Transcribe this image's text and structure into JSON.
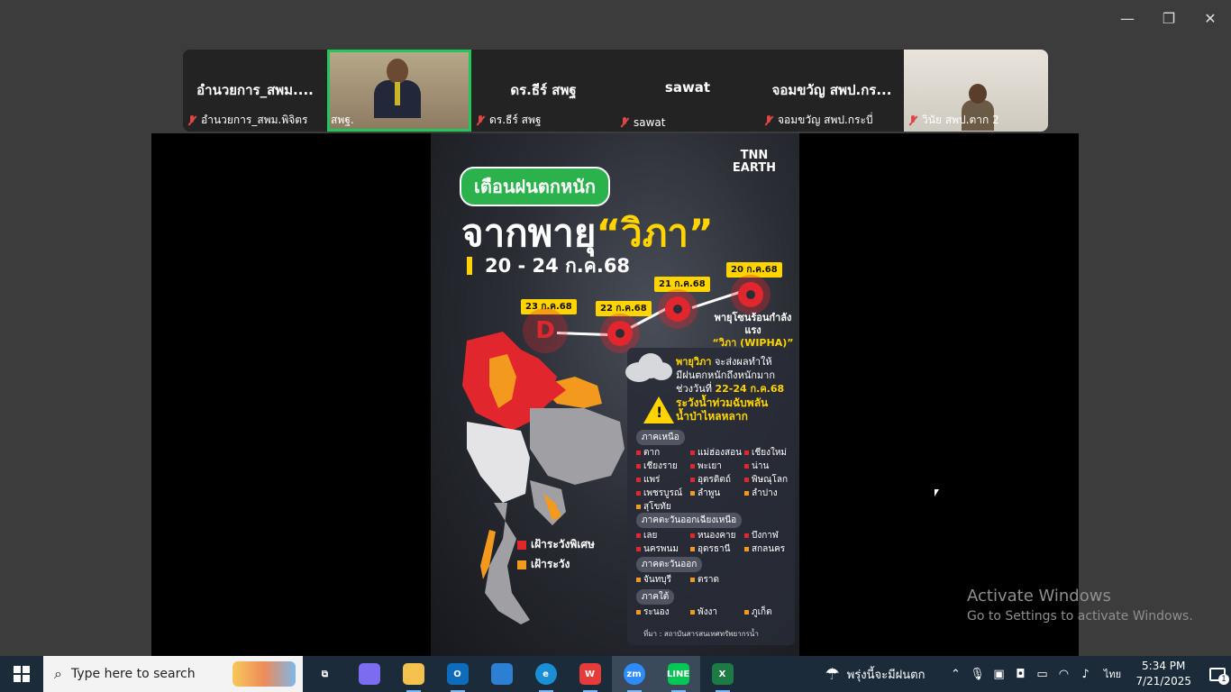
{
  "window": {
    "minimize": "—",
    "restore": "❐",
    "close": "✕"
  },
  "participants": [
    {
      "big_name": "อำนวยการ_สพม....",
      "label": "อำนวยการ_สพม.พิจิตร",
      "video": false,
      "muted": true
    },
    {
      "big_name": "",
      "label": "สพฐ.",
      "video": true,
      "muted": false,
      "active": true
    },
    {
      "big_name": "ดร.ธีร์ สพฐ",
      "label": "ดร.ธีร์ สพฐ",
      "video": false,
      "muted": true
    },
    {
      "big_name": "sawat",
      "label": "sawat",
      "video": false,
      "muted": true
    },
    {
      "big_name": "จอมขวัญ สพป.กร...",
      "label": "จอมขวัญ สพป.กระบี่",
      "video": false,
      "muted": true
    },
    {
      "big_name": "",
      "label": "วินัย สพป.ตาก 2",
      "video": true,
      "muted": true
    }
  ],
  "poster": {
    "badge": "เตือนฝนตกหนัก",
    "title_prefix": "จากพายุ",
    "title_storm": "“วิภา”",
    "date_range": "20 - 24 ก.ค.68",
    "brand_line1": "TNN",
    "brand_line2": "EARTH",
    "track": [
      {
        "date": "23 ก.ค.68",
        "symbol": "D"
      },
      {
        "date": "22 ก.ค.68",
        "symbol": "storm"
      },
      {
        "date": "21 ก.ค.68",
        "symbol": "storm"
      },
      {
        "date": "20 ก.ค.68",
        "symbol": "storm"
      }
    ],
    "storm_label_1": "พายุโซนร้อนกำลังแรง",
    "storm_label_2": "“วิภา (WIPHA)”",
    "effect_1a": "พายุวิภา",
    "effect_1b": " จะส่งผลทำให้",
    "effect_2": "มีฝนตกหนักถึงหนักมาก",
    "effect_3a": "ช่วงวันที่ ",
    "effect_3b": "22-24 ก.ค.68",
    "warn_1": "ระวังน้ำท่วมฉับพลัน",
    "warn_2": "น้ำป่าไหลหลาก",
    "legend_red": "เฝ้าระวังพิเศษ",
    "legend_orange": "เฝ้าระวัง",
    "color_red": "#e2262d",
    "color_orange": "#f39a1e",
    "regions": {
      "north": "ภาคเหนือ",
      "northeast": "ภาคตะวันออกเฉียงเหนือ",
      "east": "ภาคตะวันออก",
      "south": "ภาคใต้"
    },
    "provinces_north": [
      {
        "name": "ตาก",
        "level": "red"
      },
      {
        "name": "แม่ฮ่องสอน",
        "level": "red"
      },
      {
        "name": "เชียงใหม่",
        "level": "red"
      },
      {
        "name": "เชียงราย",
        "level": "red"
      },
      {
        "name": "พะเยา",
        "level": "red"
      },
      {
        "name": "น่าน",
        "level": "red"
      },
      {
        "name": "แพร่",
        "level": "red"
      },
      {
        "name": "อุตรดิตถ์",
        "level": "red"
      },
      {
        "name": "พิษณุโลก",
        "level": "red"
      },
      {
        "name": "เพชรบูรณ์",
        "level": "red"
      },
      {
        "name": "ลำพูน",
        "level": "orange"
      },
      {
        "name": "ลำปาง",
        "level": "orange"
      },
      {
        "name": "สุโขทัย",
        "level": "orange"
      }
    ],
    "provinces_northeast": [
      {
        "name": "เลย",
        "level": "red"
      },
      {
        "name": "หนองคาย",
        "level": "red"
      },
      {
        "name": "บึงกาฬ",
        "level": "red"
      },
      {
        "name": "นครพนม",
        "level": "red"
      },
      {
        "name": "อุดรธานี",
        "level": "orange"
      },
      {
        "name": "สกลนคร",
        "level": "orange"
      }
    ],
    "provinces_east": [
      {
        "name": "จันทบุรี",
        "level": "orange"
      },
      {
        "name": "ตราด",
        "level": "orange"
      }
    ],
    "provinces_south": [
      {
        "name": "ระนอง",
        "level": "orange"
      },
      {
        "name": "พังงา",
        "level": "orange"
      },
      {
        "name": "ภูเก็ต",
        "level": "orange"
      }
    ],
    "source": "ที่มา : สถาบันสารสนเทศทรัพยากรน้ำ"
  },
  "activation": {
    "title": "Activate Windows",
    "subtitle": "Go to Settings to activate Windows."
  },
  "taskbar": {
    "search_placeholder": "Type here to search",
    "apps": [
      {
        "name": "task-view",
        "label": "⧉",
        "color": "transparent"
      },
      {
        "name": "copilot",
        "label": "",
        "color": "#7b6cf0"
      },
      {
        "name": "file-explorer",
        "label": "",
        "color": "#f2c14e"
      },
      {
        "name": "outlook",
        "label": "O",
        "color": "#0f6cbd"
      },
      {
        "name": "store",
        "label": "",
        "color": "#2d7fd3"
      },
      {
        "name": "edge",
        "label": "e",
        "color": "#1a8fd6"
      },
      {
        "name": "wps",
        "label": "W",
        "color": "#e63b3b"
      },
      {
        "name": "zoom",
        "label": "zm",
        "color": "#2d8cff"
      },
      {
        "name": "line",
        "label": "LINE",
        "color": "#06c755"
      },
      {
        "name": "excel",
        "label": "X",
        "color": "#1d7a45"
      }
    ],
    "weather": "พรุ่งนี้จะมีฝนตก",
    "language": "ไทย",
    "time": "5:34 PM",
    "date": "7/21/2025",
    "notifications": "1"
  }
}
